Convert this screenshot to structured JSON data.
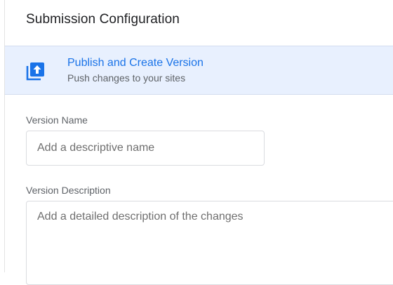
{
  "panel": {
    "title": "Submission Configuration"
  },
  "publish_option": {
    "icon": "publish-upload-icon",
    "title": "Publish and Create Version",
    "subtitle": "Push changes to your sites",
    "accent_color": "#1a73e8",
    "background_color": "#e8f0fe"
  },
  "version_name": {
    "label": "Version Name",
    "value": "",
    "placeholder": "Add a descriptive name"
  },
  "version_description": {
    "label": "Version Description",
    "value": "",
    "placeholder": "Add a detailed description of the changes"
  }
}
